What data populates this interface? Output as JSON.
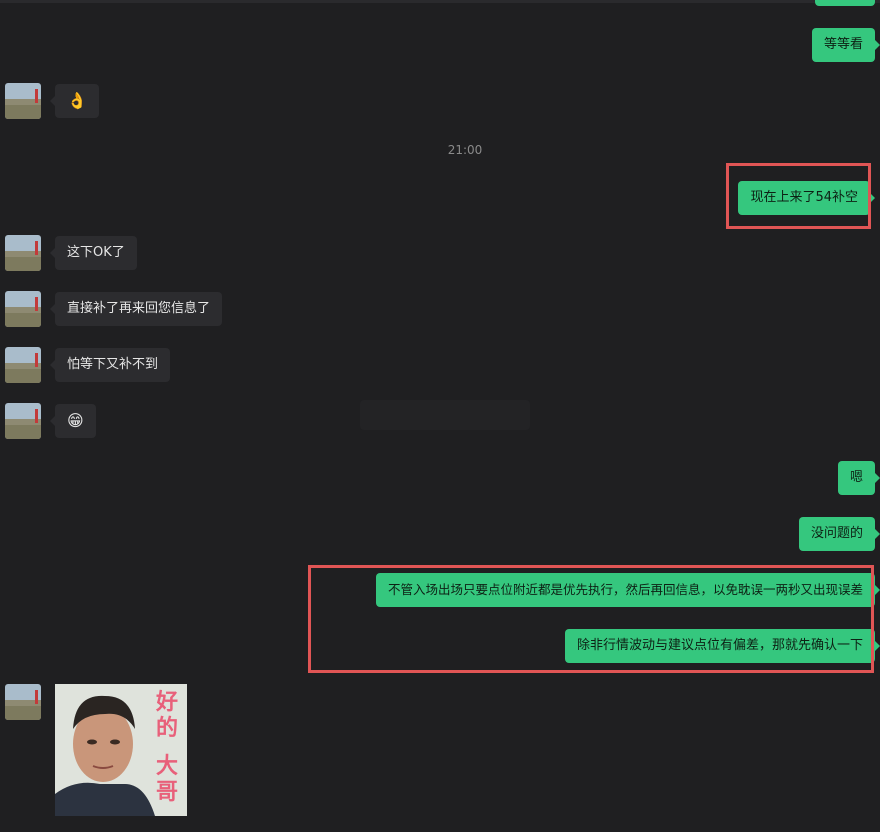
{
  "time_divider": "21:00",
  "messages": {
    "m_top_out": "等等看",
    "m_ok_emoji": "👌",
    "m_now": "现在上来了54补空",
    "m_this_ok": "这下OK了",
    "m_direct": "直接补了再来回您信息了",
    "m_afraid": "怕等下又补不到",
    "m_grin": "😁",
    "m_en": "嗯",
    "m_noproblem": "没问题的",
    "m_long1": "不管入场出场只要点位附近都是优先执行，然后再回信息，以免耽误一两秒又出现误差",
    "m_long2": "除非行情波动与建议点位有偏差，那就先确认一下"
  },
  "sticker": {
    "text_top": "好的",
    "text_bottom": "大哥"
  },
  "colors": {
    "background": "#1f1f21",
    "incoming_bubble": "#2c2c2f",
    "outgoing_bubble": "#35c77e",
    "highlight": "#e05555"
  }
}
